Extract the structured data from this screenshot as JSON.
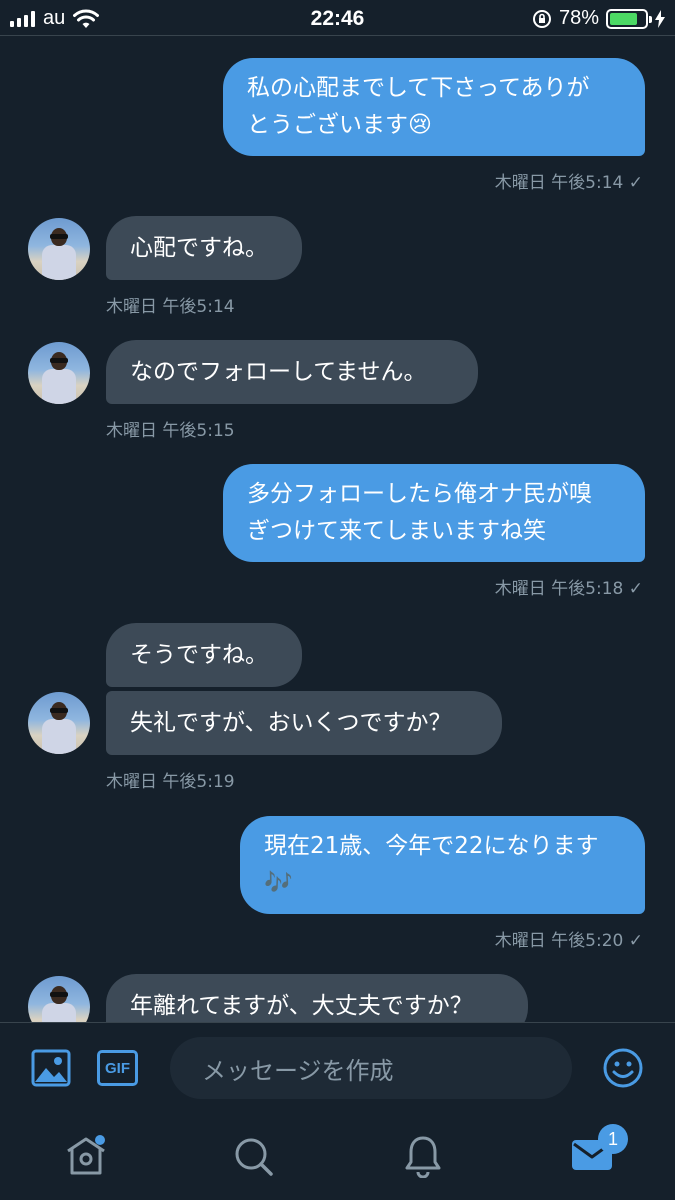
{
  "status_bar": {
    "carrier": "au",
    "time": "22:46",
    "battery_percent": "78%",
    "battery_level": 0.78
  },
  "messages": [
    {
      "dir": "out",
      "lines": [
        "私の心配までして下さってありが",
        "とうございます😢"
      ],
      "meta": "木曜日 午後5:14 ✓"
    },
    {
      "dir": "in",
      "text": "心配ですね。",
      "meta": "木曜日 午後5:14"
    },
    {
      "dir": "in",
      "text": "なのでフォローしてません。",
      "meta": "木曜日 午後5:15"
    },
    {
      "dir": "out",
      "lines": [
        "多分フォローしたら俺オナ民が嗅",
        "ぎつけて来てしまいますね笑"
      ],
      "meta": "木曜日 午後5:18 ✓"
    },
    {
      "dir": "in",
      "text": "そうですね。"
    },
    {
      "dir": "in",
      "text": "失礼ですが、おいくつですか？",
      "meta": "木曜日 午後5:19"
    },
    {
      "dir": "out",
      "lines": [
        "現在21歳、今年で22になります",
        "🎶"
      ],
      "meta": "木曜日 午後5:20 ✓"
    },
    {
      "dir": "in",
      "text": "年離れてますが、大丈夫ですか？"
    }
  ],
  "composer": {
    "placeholder": "メッセージを作成",
    "gif_label": "GIF"
  },
  "tabbar": {
    "messages_badge": "1"
  },
  "colors": {
    "background": "#15202b",
    "outgoing_bubble": "#4a9be4",
    "incoming_bubble": "#3d4a57",
    "accent": "#4a9be4",
    "meta_text": "#8899a6"
  }
}
